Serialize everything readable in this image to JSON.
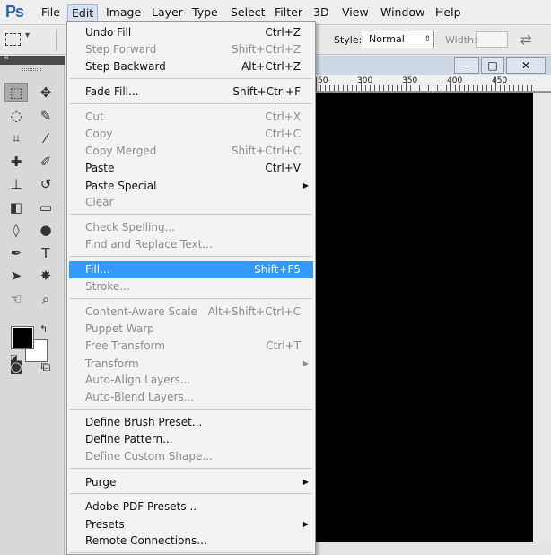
{
  "app": {
    "logo": "Ps"
  },
  "menubar": {
    "items": [
      {
        "label": "File"
      },
      {
        "label": "Edit"
      },
      {
        "label": "Image"
      },
      {
        "label": "Layer"
      },
      {
        "label": "Type"
      },
      {
        "label": "Select"
      },
      {
        "label": "Filter"
      },
      {
        "label": "3D"
      },
      {
        "label": "View"
      },
      {
        "label": "Window"
      },
      {
        "label": "Help"
      }
    ],
    "active": "Edit"
  },
  "options": {
    "style_label": "Style:",
    "style_value": "Normal",
    "width_label": "Width:",
    "width_value": ""
  },
  "ruler": {
    "labels": [
      "50",
      "300",
      "350",
      "400",
      "450"
    ]
  },
  "window_controls": {
    "minimize": "–",
    "maximize": "□",
    "close": "✕"
  },
  "edit_menu": {
    "items": [
      {
        "label": "Undo Fill",
        "shortcut": "Ctrl+Z",
        "enabled": true
      },
      {
        "label": "Step Forward",
        "shortcut": "Shift+Ctrl+Z",
        "enabled": false
      },
      {
        "label": "Step Backward",
        "shortcut": "Alt+Ctrl+Z",
        "enabled": true
      },
      {
        "label": "Fade Fill...",
        "shortcut": "Shift+Ctrl+F",
        "enabled": true
      },
      {
        "label": "Cut",
        "shortcut": "Ctrl+X",
        "enabled": false
      },
      {
        "label": "Copy",
        "shortcut": "Ctrl+C",
        "enabled": false
      },
      {
        "label": "Copy Merged",
        "shortcut": "Shift+Ctrl+C",
        "enabled": false
      },
      {
        "label": "Paste",
        "shortcut": "Ctrl+V",
        "enabled": true
      },
      {
        "label": "Paste Special",
        "shortcut": "",
        "enabled": true,
        "submenu": true
      },
      {
        "label": "Clear",
        "shortcut": "",
        "enabled": false
      },
      {
        "label": "Check Spelling...",
        "shortcut": "",
        "enabled": false
      },
      {
        "label": "Find and Replace Text...",
        "shortcut": "",
        "enabled": false
      },
      {
        "label": "Fill...",
        "shortcut": "Shift+F5",
        "enabled": true,
        "highlighted": true
      },
      {
        "label": "Stroke...",
        "shortcut": "",
        "enabled": false
      },
      {
        "label": "Content-Aware Scale",
        "shortcut": "Alt+Shift+Ctrl+C",
        "enabled": false
      },
      {
        "label": "Puppet Warp",
        "shortcut": "",
        "enabled": false
      },
      {
        "label": "Free Transform",
        "shortcut": "Ctrl+T",
        "enabled": false
      },
      {
        "label": "Transform",
        "shortcut": "",
        "enabled": false,
        "submenu": true
      },
      {
        "label": "Auto-Align Layers...",
        "shortcut": "",
        "enabled": false
      },
      {
        "label": "Auto-Blend Layers...",
        "shortcut": "",
        "enabled": false
      },
      {
        "label": "Define Brush Preset...",
        "shortcut": "",
        "enabled": true
      },
      {
        "label": "Define Pattern...",
        "shortcut": "",
        "enabled": true
      },
      {
        "label": "Define Custom Shape...",
        "shortcut": "",
        "enabled": false
      },
      {
        "label": "Purge",
        "shortcut": "",
        "enabled": true,
        "submenu": true
      },
      {
        "label": "Adobe PDF Presets...",
        "shortcut": "",
        "enabled": true
      },
      {
        "label": "Presets",
        "shortcut": "",
        "enabled": true,
        "submenu": true
      },
      {
        "label": "Remote Connections...",
        "shortcut": "",
        "enabled": true
      }
    ]
  },
  "tools": [
    {
      "icon": "marquee-icon",
      "glyph": "⬚"
    },
    {
      "icon": "move-icon",
      "glyph": "✥"
    },
    {
      "icon": "lasso-icon",
      "glyph": "◌"
    },
    {
      "icon": "quick-select-icon",
      "glyph": "✎"
    },
    {
      "icon": "crop-icon",
      "glyph": "⌗"
    },
    {
      "icon": "eyedropper-icon",
      "glyph": "⁄"
    },
    {
      "icon": "healing-brush-icon",
      "glyph": "✚"
    },
    {
      "icon": "brush-icon",
      "glyph": "✐"
    },
    {
      "icon": "clone-stamp-icon",
      "glyph": "⊥"
    },
    {
      "icon": "history-brush-icon",
      "glyph": "↺"
    },
    {
      "icon": "eraser-icon",
      "glyph": "◧"
    },
    {
      "icon": "gradient-icon",
      "glyph": "▭"
    },
    {
      "icon": "blur-icon",
      "glyph": "◊"
    },
    {
      "icon": "dodge-icon",
      "glyph": "●"
    },
    {
      "icon": "pen-icon",
      "glyph": "✒"
    },
    {
      "icon": "type-icon",
      "glyph": "T"
    },
    {
      "icon": "path-select-icon",
      "glyph": "➤"
    },
    {
      "icon": "custom-shape-icon",
      "glyph": "✸"
    },
    {
      "icon": "hand-icon",
      "glyph": "☜"
    },
    {
      "icon": "zoom-icon",
      "glyph": "⌕"
    },
    {
      "icon": "quick-mask-icon",
      "glyph": "◙"
    },
    {
      "icon": "screen-mode-icon",
      "glyph": "⧉"
    }
  ],
  "colors": {
    "foreground": "#000000",
    "background": "#ffffff",
    "highlight": "#3399ff"
  }
}
